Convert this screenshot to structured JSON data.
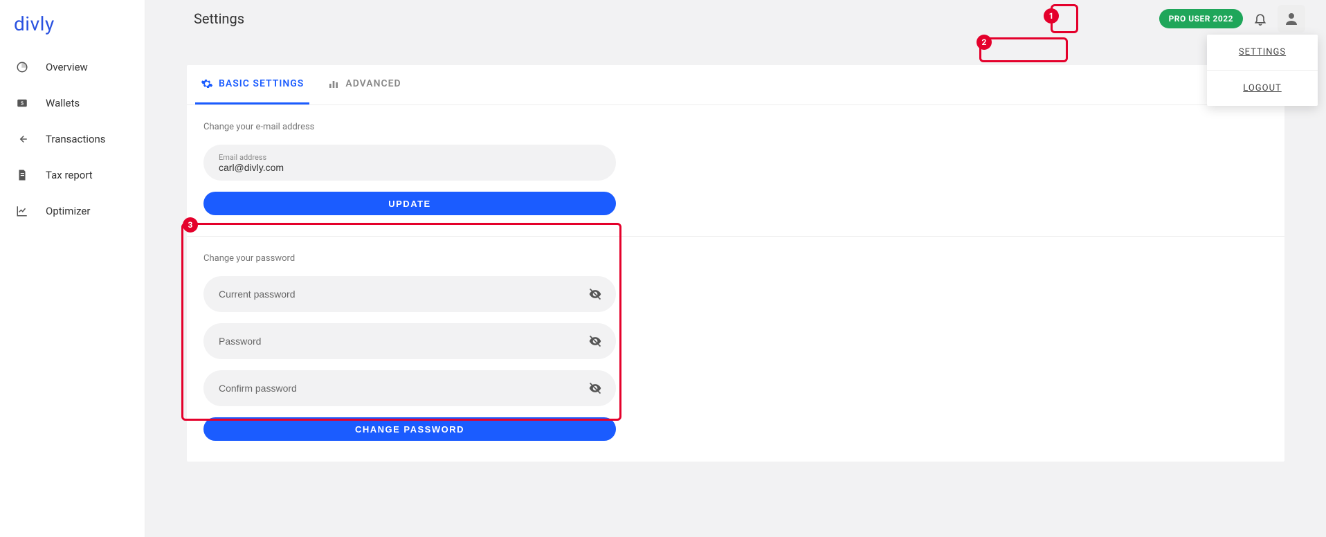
{
  "brand": "divly",
  "sidebar": {
    "items": [
      {
        "label": "Overview"
      },
      {
        "label": "Wallets"
      },
      {
        "label": "Transactions"
      },
      {
        "label": "Tax report"
      },
      {
        "label": "Optimizer"
      }
    ]
  },
  "header": {
    "title": "Settings",
    "badge": "PRO USER 2022"
  },
  "dropdown": {
    "settings": "SETTINGS",
    "logout": "LOGOUT"
  },
  "tabs": {
    "basic": "BASIC SETTINGS",
    "advanced": "ADVANCED"
  },
  "email_section": {
    "heading": "Change your e-mail address",
    "label": "Email address",
    "value": "carl@divly.com",
    "button": "UPDATE"
  },
  "password_section": {
    "heading": "Change your password",
    "current_placeholder": "Current password",
    "new_placeholder": "Password",
    "confirm_placeholder": "Confirm password",
    "button": "CHANGE PASSWORD"
  },
  "annotations": {
    "a1": "1",
    "a2": "2",
    "a3": "3"
  }
}
